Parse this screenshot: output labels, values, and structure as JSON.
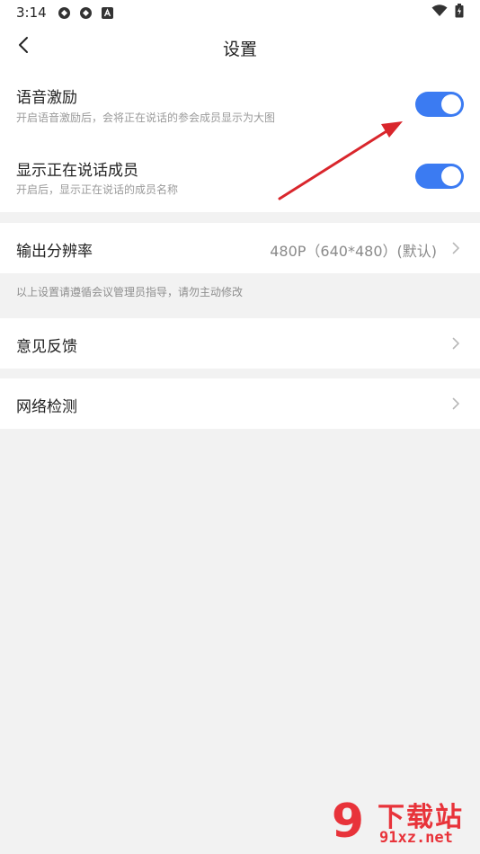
{
  "status_bar": {
    "time": "3:14",
    "icons": [
      "sync-icon",
      "sync-icon",
      "a-notification-icon"
    ],
    "right_icons": [
      "wifi-icon",
      "battery-icon"
    ]
  },
  "nav": {
    "back_icon": "chevron-left-icon",
    "title": "设置"
  },
  "settings": {
    "voice_motivation": {
      "title": "语音激励",
      "subtitle": "开启语音激励后，会将正在说话的参会成员显示为大图",
      "enabled": true
    },
    "show_speaking": {
      "title": "显示正在说话成员",
      "subtitle": "开启后，显示正在说话的成员名称",
      "enabled": true
    },
    "output_resolution": {
      "title": "输出分辨率",
      "value": "480P（640*480）(默认)"
    },
    "note": "以上设置请遵循会议管理员指导，请勿主动修改",
    "feedback": {
      "title": "意见反馈"
    },
    "network_check": {
      "title": "网络检测"
    }
  },
  "watermark": {
    "logo_text": "9",
    "cn_text": "下载站",
    "url_text": "91xz.net"
  },
  "colors": {
    "accent": "#3b7bf2",
    "background": "#f2f2f2",
    "card": "#ffffff",
    "annotation_arrow": "#d9262c",
    "watermark": "#e8333a"
  }
}
